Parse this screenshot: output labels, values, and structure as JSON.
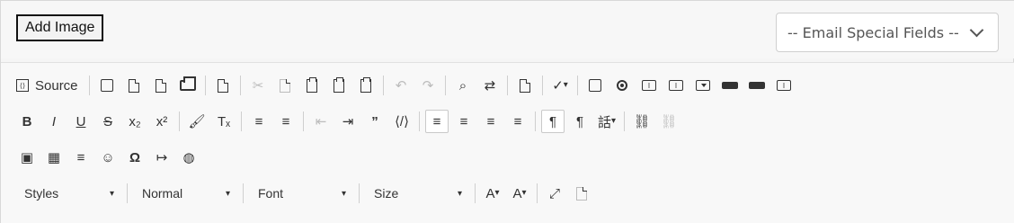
{
  "top": {
    "add_image_label": "Add Image",
    "email_fields": {
      "selected": "-- Email Special Fields --"
    }
  },
  "toolbar": {
    "source_label": "Source",
    "styles": "Styles",
    "format": "Normal",
    "font": "Font",
    "size": "Size",
    "source_icon": "source-icon"
  }
}
